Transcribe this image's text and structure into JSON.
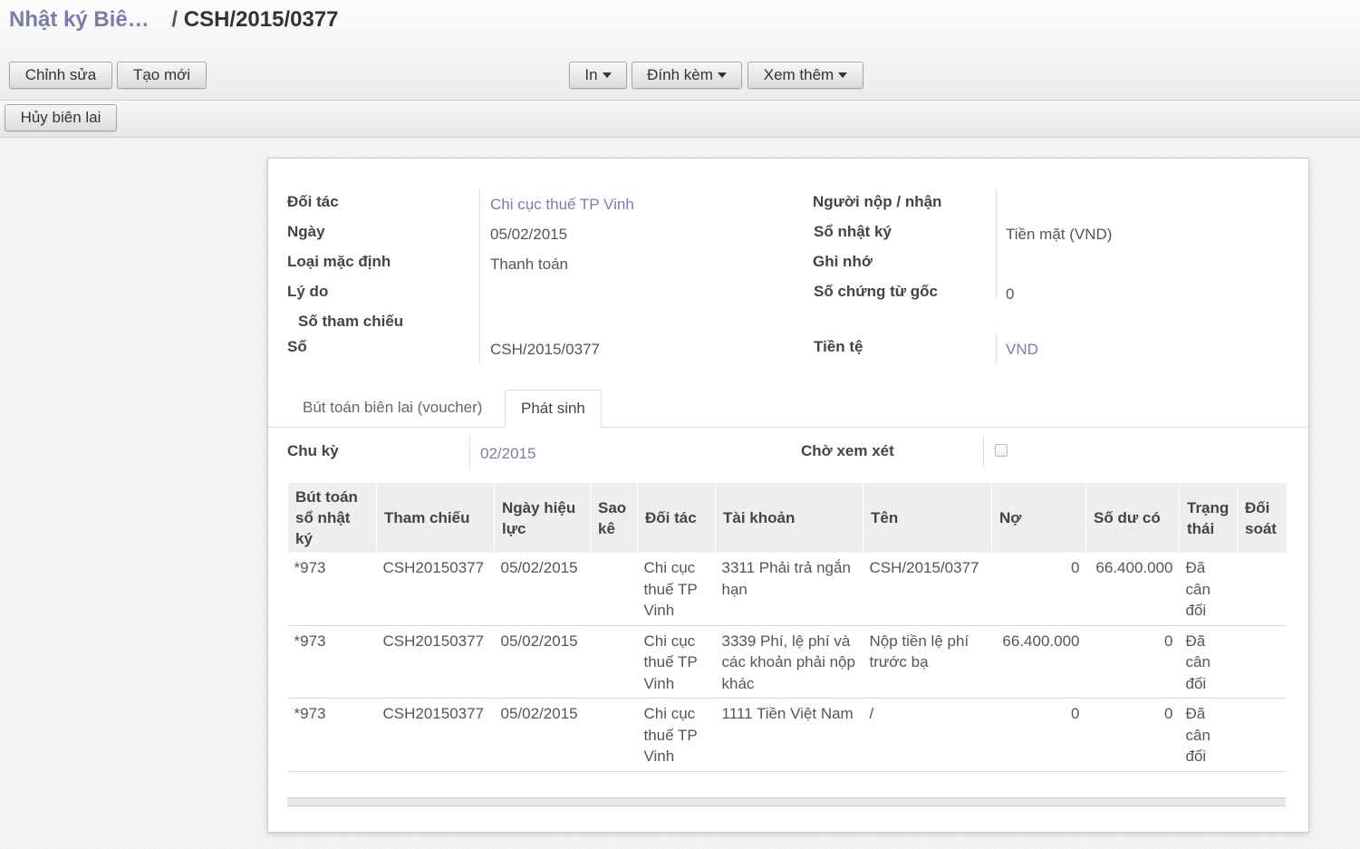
{
  "breadcrumb": {
    "parent": "Nhật ký Biê…",
    "separator": "/",
    "current": "CSH/2015/0377"
  },
  "toolbar": {
    "edit_label": "Chỉnh sửa",
    "create_label": "Tạo mới",
    "print_label": "In",
    "attach_label": "Đính kèm",
    "more_label": "Xem thêm"
  },
  "statusbar": {
    "cancel_label": "Hủy biên lai"
  },
  "form": {
    "partner_label": "Đối tác",
    "partner_value": "Chi cục thuế TP Vinh",
    "date_label": "Ngày",
    "date_value": "05/02/2015",
    "default_type_label": "Loại mặc định",
    "default_type_value": "Thanh toán",
    "reason_label": "Lý do",
    "ref_label": "Số tham chiếu",
    "number_label": "Số",
    "number_value": "CSH/2015/0377",
    "payer_label": "Người nộp / nhận",
    "journal_label": "Sổ nhật ký",
    "journal_value": "Tiền mặt (VND)",
    "memo_label": "Ghi nhớ",
    "orig_docs_label": "Số chứng từ gốc",
    "orig_docs_value": "0",
    "currency_label": "Tiền tệ",
    "currency_value": "VND"
  },
  "tabs": [
    {
      "label": "Bút toán biên lai (voucher)"
    },
    {
      "label": "Phát sinh"
    }
  ],
  "other": {
    "period_label": "Chu kỳ",
    "period_value": "02/2015",
    "review_label": "Chờ xem xét"
  },
  "table": {
    "headers": [
      "Bút toán sổ nhật ký",
      "Tham chiếu",
      "Ngày hiệu lực",
      "Sao kê",
      "Đối tác",
      "Tài khoản",
      "Tên",
      "Nợ",
      "Số dư có",
      "Trạng thái",
      "Đối soát"
    ],
    "rows": [
      [
        "*973",
        "CSH20150377",
        "05/02/2015",
        "",
        "Chi cục thuế TP Vinh",
        "3311 Phải trả ngắn hạn",
        "CSH/2015/0377",
        "0",
        "66.400.000",
        "Đã cân đối",
        ""
      ],
      [
        "*973",
        "CSH20150377",
        "05/02/2015",
        "",
        "Chi cục thuế TP Vinh",
        "3339 Phí, lệ phí và các khoản phải nộp khác",
        "Nộp tiền lệ phí trước bạ",
        "66.400.000",
        "0",
        "Đã cân đối",
        ""
      ],
      [
        "*973",
        "CSH20150377",
        "05/02/2015",
        "",
        "Chi cục thuế TP Vinh",
        "1111 Tiền Việt Nam",
        "/",
        "0",
        "0",
        "Đã cân đối",
        ""
      ]
    ]
  }
}
